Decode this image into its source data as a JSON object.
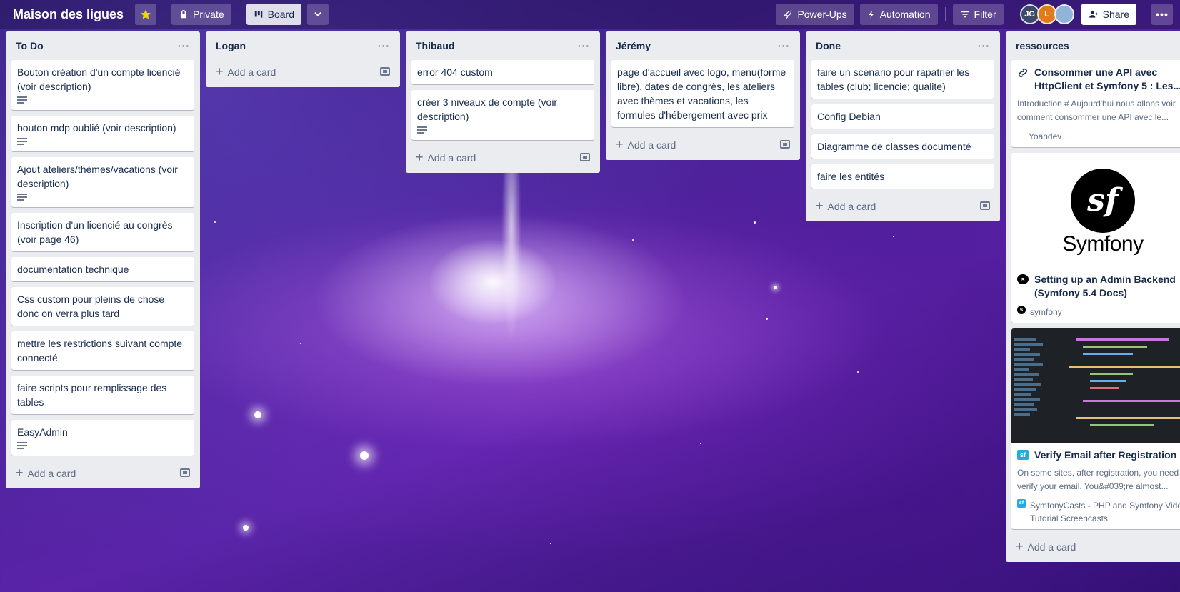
{
  "header": {
    "board_title": "Maison des ligues",
    "visibility_label": "Private",
    "view_label": "Board",
    "power_ups_label": "Power-Ups",
    "automation_label": "Automation",
    "filter_label": "Filter",
    "share_label": "Share",
    "avatars": [
      {
        "initials": "JG",
        "color": "#3b4a6b"
      },
      {
        "initials": "L",
        "color": "#e07b1a"
      },
      {
        "initials": "",
        "color": "#8fb3d9"
      }
    ]
  },
  "add_card_label": "Add a card",
  "lists": [
    {
      "title": "To Do",
      "cards": [
        {
          "text": "Bouton création d'un compte licencié (voir description)",
          "has_description": true
        },
        {
          "text": "bouton mdp oublié (voir description)",
          "has_description": true
        },
        {
          "text": "Ajout ateliers/thèmes/vacations (voir description)",
          "has_description": true
        },
        {
          "text": "Inscription d'un licencié au congrès (voir page 46)",
          "has_description": false
        },
        {
          "text": "documentation technique",
          "has_description": false
        },
        {
          "text": "Css custom pour pleins de chose donc on verra plus tard",
          "has_description": false
        },
        {
          "text": "mettre les restrictions suivant compte connecté",
          "has_description": false
        },
        {
          "text": "faire scripts pour remplissage des tables",
          "has_description": false
        },
        {
          "text": "EasyAdmin",
          "has_description": true
        }
      ]
    },
    {
      "title": "Logan",
      "cards": []
    },
    {
      "title": "Thibaud",
      "cards": [
        {
          "text": "error 404 custom",
          "has_description": false
        },
        {
          "text": "créer 3 niveaux de compte (voir description)",
          "has_description": true
        }
      ]
    },
    {
      "title": "Jérémy",
      "cards": [
        {
          "text": "page d'accueil avec logo, menu(forme libre), dates de congrès, les ateliers avec thèmes et vacations, les formules d'hébergement avec prix",
          "has_description": false
        }
      ]
    },
    {
      "title": "Done",
      "cards": [
        {
          "text": "faire un scénario pour rapatrier les tables (club; licencie; qualite)",
          "has_description": false
        },
        {
          "text": "Config Debian",
          "has_description": false
        },
        {
          "text": "Diagramme de classes documenté",
          "has_description": false
        },
        {
          "text": "faire les entités",
          "has_description": false
        }
      ]
    }
  ],
  "resources": {
    "title": "ressources",
    "cards": [
      {
        "title": "Consommer une API avec HttpClient et Symfony 5 : Les...",
        "desc": "Introduction # Aujourd'hui nous allons voir comment consommer une API avec le...",
        "source": "Yoandev",
        "icon": "link-icon"
      },
      {
        "cover_word": "Symfony",
        "cover_monogram": "sf",
        "title": "Setting up an Admin Backend (Symfony 5.4 Docs)",
        "source": "symfony",
        "icon": "symfony-icon"
      },
      {
        "title": "Verify Email after Registration",
        "desc": "On some sites, after registration, you need to verify your email. You&#039;re almost...",
        "source": "SymfonyCasts - PHP and Symfony Video Tutorial Screencasts",
        "icon": "symfonycasts-icon"
      }
    ]
  },
  "colors": {
    "list_bg": "#ebecf0",
    "card_bg": "#ffffff",
    "text": "#172b4d",
    "muted": "#5e6c84",
    "star": "#f2d600"
  }
}
